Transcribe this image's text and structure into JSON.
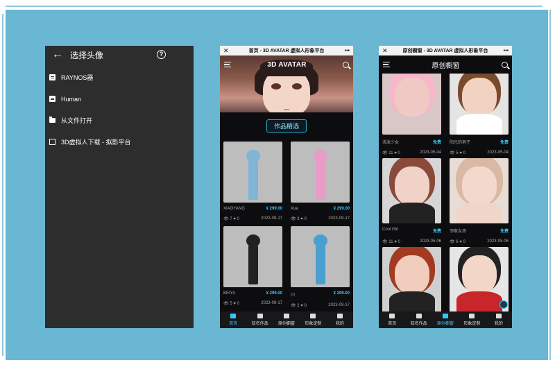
{
  "panel1": {
    "title": "选择头像",
    "items": [
      {
        "label": "RAYNOS器",
        "icon": "file-icon"
      },
      {
        "label": "Human",
        "icon": "file-icon"
      },
      {
        "label": "从文件打开",
        "icon": "folder-icon"
      },
      {
        "label": "3D虚拟人下载 - 拟影平台",
        "icon": "external-link-icon"
      }
    ]
  },
  "panel2": {
    "window_title": "首页 - 3D AVATAR 虚拟人形象平台",
    "brand": "3D AVATAR",
    "section_title": "作品精选",
    "cards": [
      {
        "name": "XIAOYANG",
        "price": "¥ 299.00",
        "views": "7",
        "likes": "0",
        "date": "2023-09-17"
      },
      {
        "name": "Xue",
        "price": "¥ 299.00",
        "views": "3",
        "likes": "0",
        "date": "2023-09-17"
      },
      {
        "name": "BEIYA",
        "price": "¥ 299.00",
        "views": "5",
        "likes": "0",
        "date": "2023-09-17"
      },
      {
        "name": "川",
        "price": "¥ 299.00",
        "views": "2",
        "likes": "0",
        "date": "2023-09-17"
      }
    ],
    "tabs": [
      "首页",
      "知名作品",
      "原创橱窗",
      "形象定制",
      "我的"
    ]
  },
  "panel3": {
    "window_title": "原创橱窗 - 3D AVATAR 虚拟人形象平台",
    "title": "原创橱窗",
    "cards": [
      {
        "name": "活泼少女",
        "price": "免费",
        "views": "11",
        "likes": "0",
        "date": "2023-05-04"
      },
      {
        "name": "阳光的男子",
        "price": "免费",
        "views": "5",
        "likes": "0",
        "date": "2023-05-04"
      },
      {
        "name": "Cool Girl",
        "price": "免费",
        "views": "11",
        "likes": "0",
        "date": "2023-05-06"
      },
      {
        "name": "邻家女孩",
        "price": "免费",
        "views": "6",
        "likes": "0",
        "date": "2023-05-06"
      },
      {
        "name": "",
        "price": "",
        "views": "",
        "likes": "",
        "date": ""
      },
      {
        "name": "",
        "price": "",
        "views": "",
        "likes": "",
        "date": ""
      }
    ],
    "tabs": [
      "首页",
      "知名作品",
      "原创橱窗",
      "形象定制",
      "我的"
    ]
  },
  "colors": {
    "accent": "#35c7ff",
    "background": "#6ab7d3"
  }
}
